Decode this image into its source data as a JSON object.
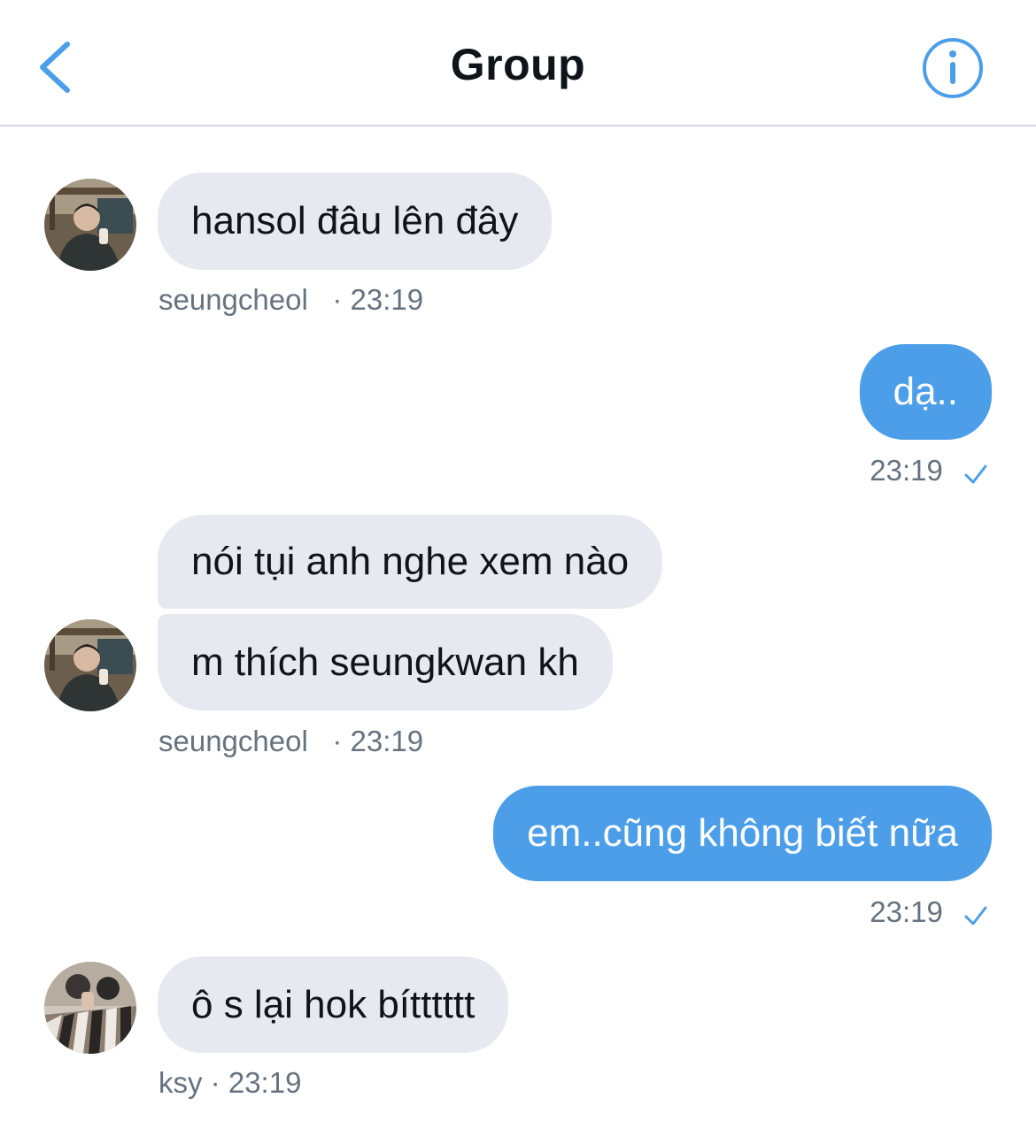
{
  "header": {
    "title": "Group",
    "back_icon": "chevron-left-icon",
    "info_icon": "info-circle-icon",
    "accent": "#4c9ee9"
  },
  "messages": [
    {
      "direction": "in",
      "text": "hansol đâu lên đây",
      "sender": "seungcheol",
      "separator": "·",
      "time": "23:19"
    },
    {
      "direction": "out",
      "text": "dạ..",
      "time": "23:19",
      "status_icon": "check-icon"
    },
    {
      "direction": "in",
      "text": "nói tụi anh nghe xem nào"
    },
    {
      "direction": "in",
      "text": "m thích seungkwan kh",
      "sender": "seungcheol",
      "separator": "·",
      "time": "23:19"
    },
    {
      "direction": "out",
      "text": "em..cũng không biết nữa",
      "time": "23:19",
      "status_icon": "check-icon"
    },
    {
      "direction": "in",
      "text": "ô s lại hok bítttttt",
      "sender": "ksy",
      "separator": "·",
      "time": "23:19"
    }
  ],
  "colors": {
    "incoming_bubble": "#e6e9ef",
    "outgoing_bubble": "#4c9ee9",
    "meta_text": "#66737f"
  }
}
